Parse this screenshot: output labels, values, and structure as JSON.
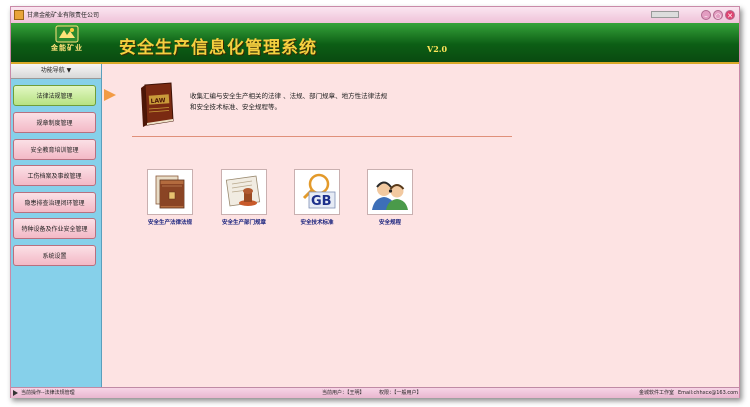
{
  "window": {
    "title": "甘肃金能矿业有限责任公司",
    "controls": {
      "minimize": "–",
      "maximize": "○",
      "close": "✕"
    }
  },
  "banner": {
    "logo_text": "金能矿业",
    "system_title": "安全生产信息化管理系统",
    "version": "V2.0"
  },
  "sidebar": {
    "header": "功能导航 ▼",
    "items": [
      {
        "label": "法律法规管理",
        "active": true
      },
      {
        "label": "规章制度管理",
        "active": false
      },
      {
        "label": "安全教育培训管理",
        "active": false
      },
      {
        "label": "工伤档案及事故管理",
        "active": false
      },
      {
        "label": "隐患排查治理闭环管理",
        "active": false
      },
      {
        "label": "特种设备及作业安全管理",
        "active": false
      },
      {
        "label": "系统设置",
        "active": false
      }
    ]
  },
  "main": {
    "intro_line1": "收集汇编与安全生产相关的法律 、法规、部门规章、地方性法律法规",
    "intro_line2": "和安全技术标准、安全规程等。",
    "book_label": "LAW",
    "modules": [
      {
        "label": "安全生产法律法规",
        "icon": "law-files-icon"
      },
      {
        "label": "安全生产部门规章",
        "icon": "stamp-document-icon"
      },
      {
        "label": "安全技术标准",
        "icon": "gb-standard-search-icon",
        "badge": "GB"
      },
      {
        "label": "安全规程",
        "icon": "support-people-icon"
      }
    ]
  },
  "statusbar": {
    "operation": "当前操作--法律法规管理",
    "current_user": "当前用户：【王明】",
    "permission": "权限：【一般用户】",
    "studio": "金城软件工作室",
    "email": "Email:chhxcx@163.com"
  },
  "colors": {
    "banner_green": "#0c5e15",
    "sidebar_blue": "#86d0ea",
    "content_pink": "#fde3e3",
    "title_gold": "#f5d040",
    "active_nav": "#b7e282"
  }
}
